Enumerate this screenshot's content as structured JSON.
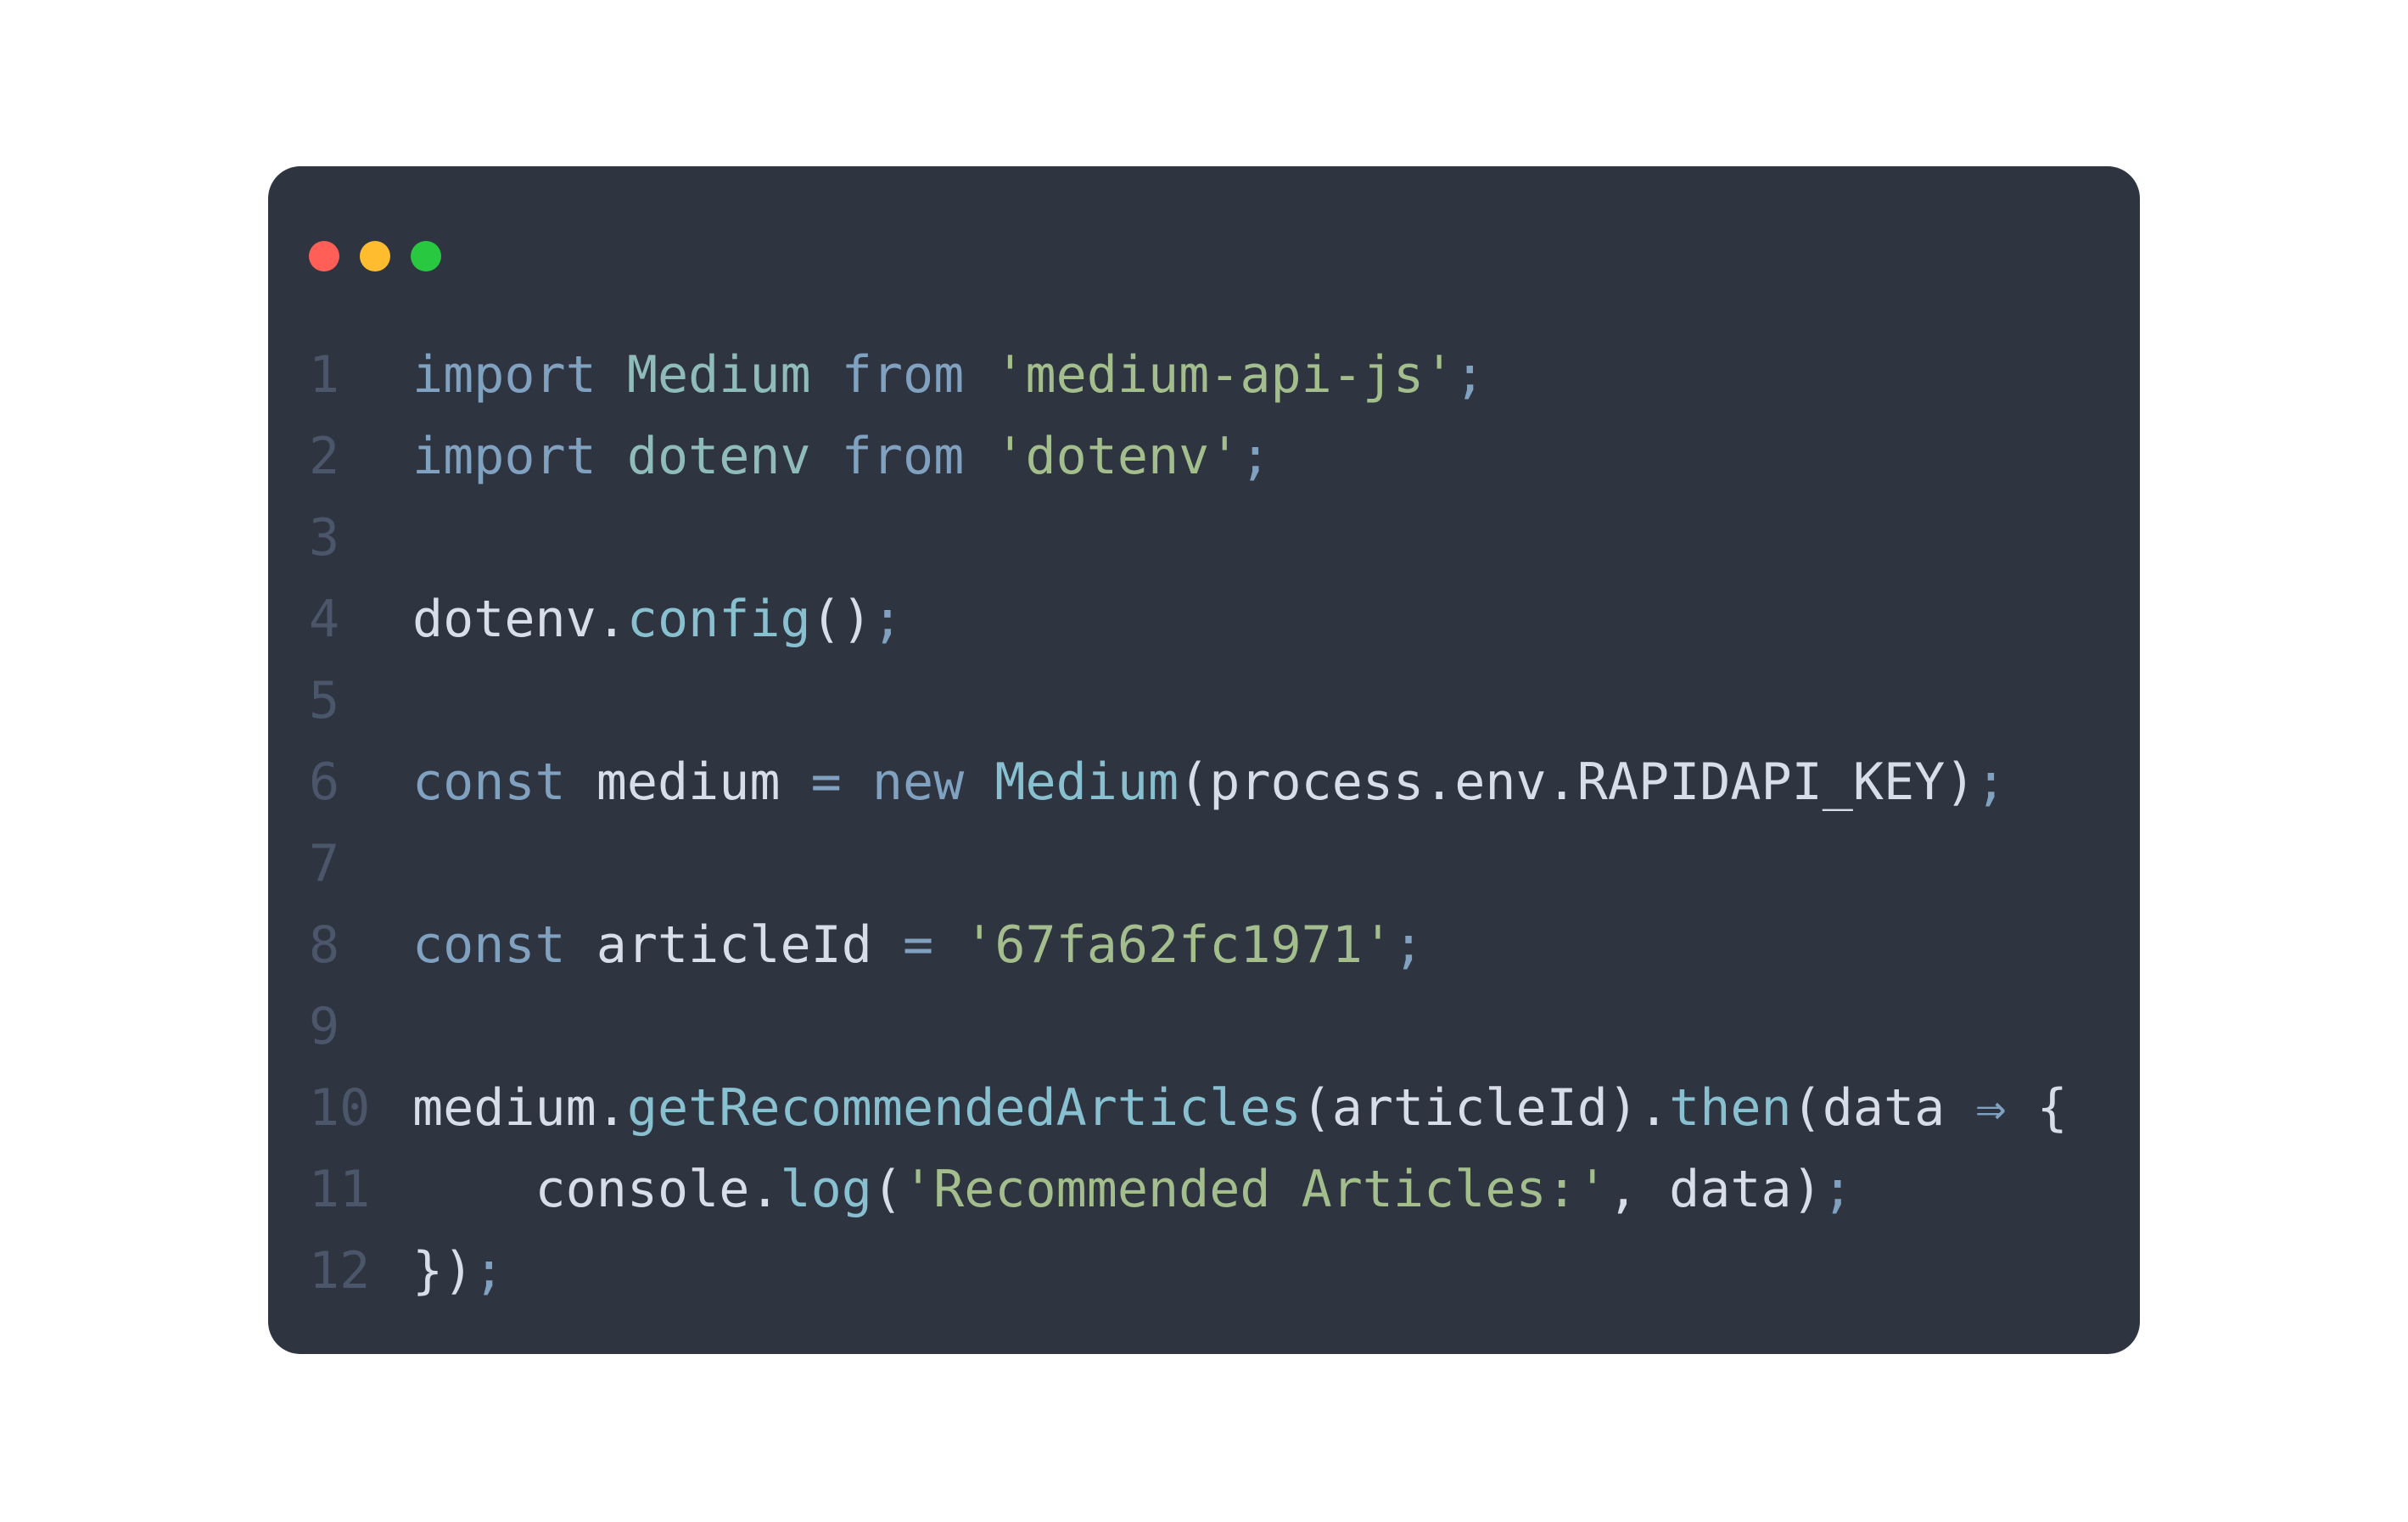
{
  "window": {
    "traffic_lights": [
      {
        "name": "close",
        "color": "#ff5f57"
      },
      {
        "name": "minimize",
        "color": "#febc2e"
      },
      {
        "name": "zoom",
        "color": "#28c840"
      }
    ]
  },
  "colors": {
    "background": "#2e3440",
    "line_number": "#4c566a",
    "keyword": "#81a1c1",
    "class": "#8fbcbb",
    "string": "#a3be8c",
    "function": "#88c0d0",
    "plain": "#d8dee9",
    "punct": "#81a1c1"
  },
  "code_lines": [
    {
      "number": "1",
      "tokens": [
        {
          "t": "import",
          "k": "keyword"
        },
        {
          "t": " ",
          "k": "plain"
        },
        {
          "t": "Medium",
          "k": "class"
        },
        {
          "t": " ",
          "k": "plain"
        },
        {
          "t": "from",
          "k": "keyword"
        },
        {
          "t": " ",
          "k": "plain"
        },
        {
          "t": "'medium-api-js'",
          "k": "string"
        },
        {
          "t": ";",
          "k": "punct"
        }
      ]
    },
    {
      "number": "2",
      "tokens": [
        {
          "t": "import",
          "k": "keyword"
        },
        {
          "t": " ",
          "k": "plain"
        },
        {
          "t": "dotenv",
          "k": "class"
        },
        {
          "t": " ",
          "k": "plain"
        },
        {
          "t": "from",
          "k": "keyword"
        },
        {
          "t": " ",
          "k": "plain"
        },
        {
          "t": "'dotenv'",
          "k": "string"
        },
        {
          "t": ";",
          "k": "punct"
        }
      ]
    },
    {
      "number": "3",
      "tokens": []
    },
    {
      "number": "4",
      "tokens": [
        {
          "t": "dotenv",
          "k": "plain"
        },
        {
          "t": ".",
          "k": "plain"
        },
        {
          "t": "config",
          "k": "function"
        },
        {
          "t": "()",
          "k": "plain"
        },
        {
          "t": ";",
          "k": "punct"
        }
      ]
    },
    {
      "number": "5",
      "tokens": []
    },
    {
      "number": "6",
      "tokens": [
        {
          "t": "const",
          "k": "keyword"
        },
        {
          "t": " medium ",
          "k": "plain"
        },
        {
          "t": "=",
          "k": "keyword"
        },
        {
          "t": " ",
          "k": "plain"
        },
        {
          "t": "new",
          "k": "keyword"
        },
        {
          "t": " ",
          "k": "plain"
        },
        {
          "t": "Medium",
          "k": "function"
        },
        {
          "t": "(process.env.RAPIDAPI_KEY)",
          "k": "plain"
        },
        {
          "t": ";",
          "k": "punct"
        }
      ]
    },
    {
      "number": "7",
      "tokens": []
    },
    {
      "number": "8",
      "tokens": [
        {
          "t": "const",
          "k": "keyword"
        },
        {
          "t": " articleId ",
          "k": "plain"
        },
        {
          "t": "=",
          "k": "keyword"
        },
        {
          "t": " ",
          "k": "plain"
        },
        {
          "t": "'67fa62fc1971'",
          "k": "string"
        },
        {
          "t": ";",
          "k": "punct"
        }
      ]
    },
    {
      "number": "9",
      "tokens": []
    },
    {
      "number": "10",
      "tokens": [
        {
          "t": "medium.",
          "k": "plain"
        },
        {
          "t": "getRecommendedArticles",
          "k": "function"
        },
        {
          "t": "(articleId).",
          "k": "plain"
        },
        {
          "t": "then",
          "k": "function"
        },
        {
          "t": "(data ",
          "k": "plain"
        },
        {
          "t": "⇒",
          "k": "keyword"
        },
        {
          "t": " {",
          "k": "plain"
        }
      ]
    },
    {
      "number": "11",
      "tokens": [
        {
          "t": "    console.",
          "k": "plain"
        },
        {
          "t": "log",
          "k": "function"
        },
        {
          "t": "(",
          "k": "plain"
        },
        {
          "t": "'Recommended Articles:'",
          "k": "string"
        },
        {
          "t": ", data)",
          "k": "plain"
        },
        {
          "t": ";",
          "k": "punct"
        }
      ]
    },
    {
      "number": "12",
      "tokens": [
        {
          "t": "})",
          "k": "plain"
        },
        {
          "t": ";",
          "k": "punct"
        }
      ]
    }
  ]
}
